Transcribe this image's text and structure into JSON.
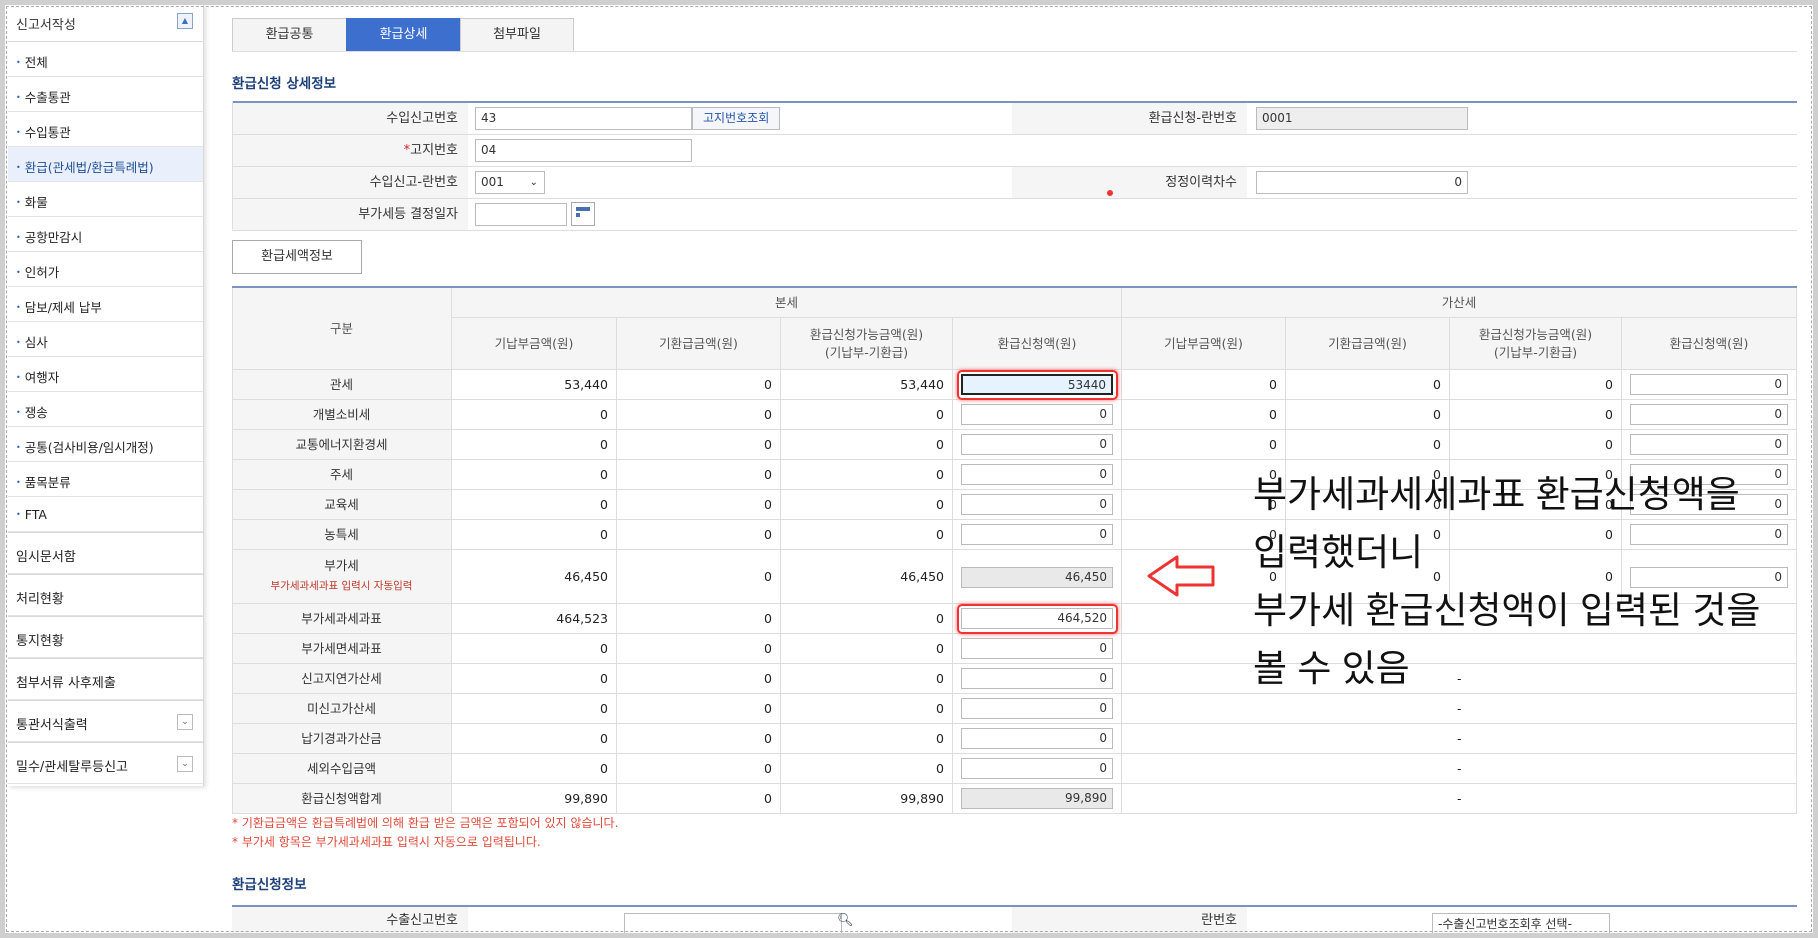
{
  "sidebar": {
    "header": "신고서작성",
    "items": [
      {
        "label": "전체"
      },
      {
        "label": "수출통관"
      },
      {
        "label": "수입통관"
      },
      {
        "label": "환급(관세법/환급특례법)",
        "active": true
      },
      {
        "label": "화물"
      },
      {
        "label": "공항만감시"
      },
      {
        "label": "인허가"
      },
      {
        "label": "담보/제세 납부"
      },
      {
        "label": "심사"
      },
      {
        "label": "여행자"
      },
      {
        "label": "쟁송"
      },
      {
        "label": "공통(검사비용/임시개정)"
      },
      {
        "label": "품목분류"
      },
      {
        "label": "FTA"
      }
    ],
    "groups": [
      {
        "label": "임시문서함"
      },
      {
        "label": "처리현황"
      },
      {
        "label": "통지현황"
      },
      {
        "label": "첨부서류 사후제출"
      },
      {
        "label": "통관서식출력",
        "expandable": true
      },
      {
        "label": "밀수/관세탈루등신고",
        "expandable": true
      }
    ]
  },
  "tabs": [
    {
      "label": "환급공통"
    },
    {
      "label": "환급상세",
      "active": true
    },
    {
      "label": "첨부파일"
    }
  ],
  "detail_section_title": "환급신청 상세정보",
  "form": {
    "import_no_label": "수입신고번호",
    "import_no_value": "43",
    "notice_lookup_button": "고지번호조회",
    "refund_line_label": "환급신청-란번호",
    "refund_line_value": "0001",
    "notice_no_label": "고지번호",
    "notice_no_req": "*",
    "notice_no_value": "04",
    "import_line_label": "수입신고-란번호",
    "import_line_value": "001",
    "revision_label": "정정이력차수",
    "revision_value": "0",
    "vat_date_label": "부가세등 결정일자",
    "vat_date_value": ""
  },
  "tax_button": "환급세액정보",
  "grid": {
    "col_category": "구분",
    "group_main": "본세",
    "group_add": "가산세",
    "col_paid": "기납부금액(원)",
    "col_refunded": "기환급금액(원)",
    "col_available": "환급신청가능금액(원)",
    "col_available_sub": "(기납부-기환급)",
    "col_request": "환급신청액(원)",
    "vat_note": "부가세과세과표 입력시 자동입력",
    "rows": [
      {
        "label": "관세",
        "paid": "53,440",
        "refunded": "0",
        "avail": "53,440",
        "req": "53440",
        "a_paid": "0",
        "a_ref": "0",
        "a_avail": "0",
        "a_req": "0"
      },
      {
        "label": "개별소비세",
        "paid": "0",
        "refunded": "0",
        "avail": "0",
        "req": "0",
        "a_paid": "0",
        "a_ref": "0",
        "a_avail": "0",
        "a_req": "0"
      },
      {
        "label": "교통에너지환경세",
        "paid": "0",
        "refunded": "0",
        "avail": "0",
        "req": "0",
        "a_paid": "0",
        "a_ref": "0",
        "a_avail": "0",
        "a_req": "0"
      },
      {
        "label": "주세",
        "paid": "0",
        "refunded": "0",
        "avail": "0",
        "req": "0",
        "a_paid": "0",
        "a_ref": "0",
        "a_avail": "0",
        "a_req": "0"
      },
      {
        "label": "교육세",
        "paid": "0",
        "refunded": "0",
        "avail": "0",
        "req": "0",
        "a_paid": "0",
        "a_ref": "0",
        "a_avail": "0",
        "a_req": "0"
      },
      {
        "label": "농특세",
        "paid": "0",
        "refunded": "0",
        "avail": "0",
        "req": "0",
        "a_paid": "0",
        "a_ref": "0",
        "a_avail": "0",
        "a_req": "0"
      },
      {
        "label": "부가세",
        "paid": "46,450",
        "refunded": "0",
        "avail": "46,450",
        "req": "46,450",
        "a_paid": "0",
        "a_ref": "0",
        "a_avail": "0",
        "a_req": "0"
      },
      {
        "label": "부가세과세과표",
        "paid": "464,523",
        "refunded": "0",
        "avail": "0",
        "req": "464,520",
        "dash": ""
      },
      {
        "label": "부가세면세과표",
        "paid": "0",
        "refunded": "0",
        "avail": "0",
        "req": "0",
        "dash": ""
      },
      {
        "label": "신고지연가산세",
        "paid": "0",
        "refunded": "0",
        "avail": "0",
        "req": "0",
        "dash": "-"
      },
      {
        "label": "미신고가산세",
        "paid": "0",
        "refunded": "0",
        "avail": "0",
        "req": "0",
        "dash": "-"
      },
      {
        "label": "납기경과가산금",
        "paid": "0",
        "refunded": "0",
        "avail": "0",
        "req": "0",
        "dash": "-"
      },
      {
        "label": "세외수입금액",
        "paid": "0",
        "refunded": "0",
        "avail": "0",
        "req": "0",
        "dash": "-"
      },
      {
        "label": "환급신청액합계",
        "paid": "99,890",
        "refunded": "0",
        "avail": "99,890",
        "req": "99,890",
        "dash": "-"
      }
    ]
  },
  "notes": [
    "* 기환급금액은 환급특례법에 의해 환급 받은 금액은 포함되어 있지 않습니다.",
    "* 부가세 항목은 부가세과세과표 입력시 자동으로 입력됩니다."
  ],
  "refund_info_title": "환급신청정보",
  "bottom": {
    "export_no_label": "수출신고번호",
    "line_label": "란번호",
    "line_select": "-수출신고번호조회후 선택-"
  },
  "annotation": [
    "부가세과세세과표 환급신청액을",
    "입력했더니",
    "부가세 환급신청액이 입력된 것을",
    "볼 수 있음"
  ],
  "colors": {
    "accent": "#3d6fcf",
    "highlight": "#e33333",
    "note": "#e04a3a"
  }
}
